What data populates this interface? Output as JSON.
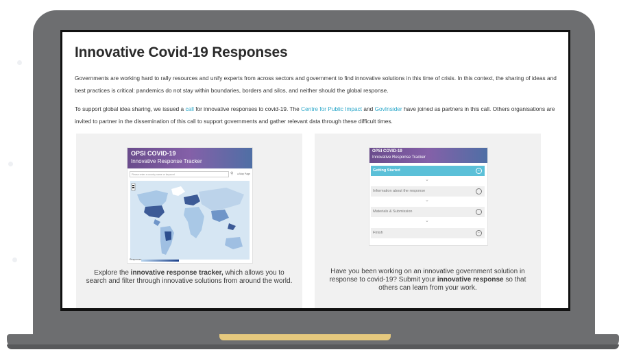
{
  "page": {
    "title": "Innovative Covid-19 Responses",
    "para1": "Governments are working hard to rally resources and unify experts from across sectors and government to find innovative solutions in this time of crisis. In this context, the sharing of ideas and best practices is critical: pandemics do not stay within boundaries, borders and silos, and neither should the global response.",
    "para2": {
      "part1": "To support global idea sharing, we issued a ",
      "link_call": "call",
      "part2": " for innovative responses to covid-19. The ",
      "link_cpi": "Centre for Public Impact",
      "part3": " and ",
      "link_govinsider": "GovInsider",
      "part4": " have joined as partners in this call. Others organisations are invited to partner in the dissemination of this call to support governments and gather relevant data through these difficult times."
    }
  },
  "left_card": {
    "banner_title": "OPSI COVID-19",
    "banner_subtitle": "Innovative Response Tracker",
    "search_placeholder": "Please enter a country name or keyword",
    "map_link": "● Map Page",
    "legend_label": "Responses",
    "caption_prefix": "Explore the ",
    "caption_bold": "innovative response tracker,",
    "caption_suffix": " which allows you to search and filter through innovative solutions from around the world."
  },
  "right_card": {
    "banner_title": "OPSI COVID-19",
    "banner_subtitle": "Innovative Response Tracker",
    "steps": [
      {
        "label": "Getting Started",
        "active": true
      },
      {
        "label": "Information about the response",
        "active": false
      },
      {
        "label": "Materials & Submission",
        "active": false
      },
      {
        "label": "Finish",
        "active": false
      }
    ],
    "caption_prefix": "Have you been working on an innovative government solution in response to covid-19? Submit your ",
    "caption_bold": "innovative response",
    "caption_suffix": " so that others can learn from your work."
  },
  "colors": {
    "link": "#2aa7c9",
    "laptop_body": "#6d6e70",
    "notch": "#e6c97e",
    "banner_purple": "#6a4c8c",
    "active_step": "#5bc0d8"
  },
  "icons": [
    "search-icon",
    "chevron-down-icon",
    "circle-indicator-icon"
  ]
}
